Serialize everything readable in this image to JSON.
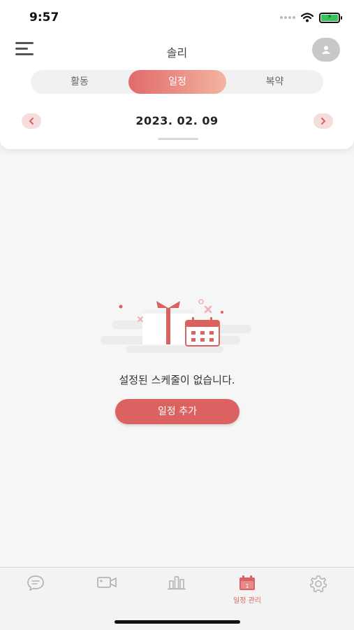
{
  "status_bar": {
    "time": "9:57"
  },
  "header": {
    "title": "솔리"
  },
  "segments": [
    {
      "label": "활동",
      "active": false
    },
    {
      "label": "일정",
      "active": true
    },
    {
      "label": "복약",
      "active": false
    }
  ],
  "date_nav": {
    "date": "2023. 02. 09"
  },
  "empty_state": {
    "message": "설정된 스케줄이 없습니다.",
    "add_button_label": "일정 추가"
  },
  "tabbar": {
    "items": [
      {
        "icon": "chat-bubble-icon",
        "label": "",
        "active": false
      },
      {
        "icon": "video-camera-icon",
        "label": "",
        "active": false
      },
      {
        "icon": "bar-chart-icon",
        "label": "",
        "active": false
      },
      {
        "icon": "calendar-icon",
        "label": "일정 관리",
        "active": true
      },
      {
        "icon": "gear-icon",
        "label": "",
        "active": false
      }
    ]
  },
  "colors": {
    "accent": "#dc6262",
    "accent_light": "#f3b4a0",
    "inactive_icon": "#b5b5b5"
  }
}
